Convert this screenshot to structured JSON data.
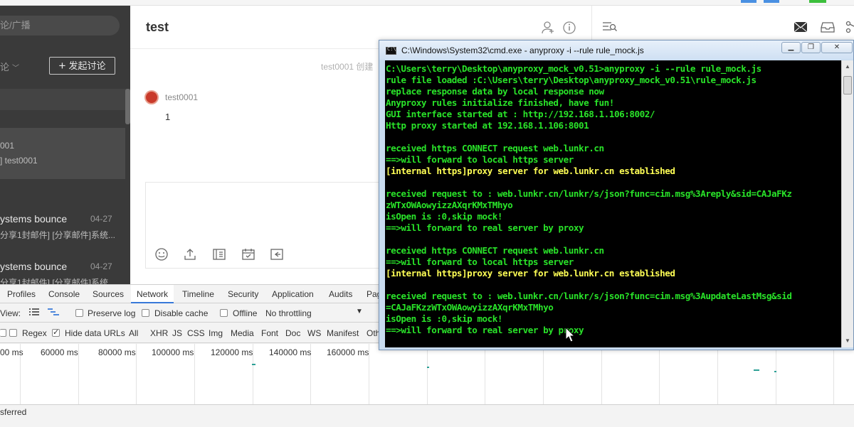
{
  "app": {
    "chat_title": "test",
    "search_placeholder": "论/广播",
    "sidebar_select": "论",
    "discuss_button": "发起讨论",
    "sidebar_active_line1": "001",
    "sidebar_active_line2": "] test0001",
    "sidebar_items": [
      {
        "title": "ystems bounce",
        "date": "04-27",
        "preview": "分享1封邮件] [分享邮件]系统..."
      },
      {
        "title": "ystems bounce",
        "date": "04-27",
        "preview": "分享1封邮件] [分享邮件]系统..."
      }
    ],
    "meta_text": "test0001  创建",
    "message_user": "test0001",
    "message_body": "1"
  },
  "devtools": {
    "tabs": [
      "Profiles",
      "Console",
      "Sources",
      "Network",
      "Timeline",
      "Security",
      "Application",
      "Audits",
      "Pag"
    ],
    "active_tab": "Network",
    "view_label": "View:",
    "preserve_log": "Preserve log",
    "disable_cache": "Disable cache",
    "offline": "Offline",
    "throttling": "No throttling",
    "regex": "Regex",
    "hide_data_urls": "Hide data URLs",
    "filters": [
      "All",
      "XHR",
      "JS",
      "CSS",
      "Img",
      "Media",
      "Font",
      "Doc",
      "WS",
      "Manifest",
      "Oth"
    ],
    "active_filter": "XHR",
    "ticks": [
      "00 ms",
      "60000 ms",
      "80000 ms",
      "100000 ms",
      "120000 ms",
      "140000 ms",
      "160000 ms"
    ],
    "status": "sferred"
  },
  "cmd": {
    "title": "C:\\Windows\\System32\\cmd.exe - anyproxy  -i --rule rule_mock.js",
    "lines": [
      {
        "text": "C:\\Users\\terry\\Desktop\\anyproxy_mock_v0.51>anyproxy -i --rule rule_mock.js",
        "color": "green"
      },
      {
        "text": "rule file loaded :C:\\Users\\terry\\Desktop\\anyproxy_mock_v0.51\\rule_mock.js",
        "color": "green"
      },
      {
        "text": "replace response data by local response now",
        "color": "green"
      },
      {
        "text": "Anyproxy rules initialize finished, have fun!",
        "color": "green"
      },
      {
        "text": "GUI interface started at : http://192.168.1.106:8002/",
        "color": "green"
      },
      {
        "text": "Http proxy started at 192.168.1.106:8001",
        "color": "green"
      },
      {
        "text": "",
        "color": "green"
      },
      {
        "text": "received https CONNECT request web.lunkr.cn",
        "color": "green"
      },
      {
        "text": "==>will forward to local https server",
        "color": "green"
      },
      {
        "text": "[internal https]proxy server for web.lunkr.cn established",
        "color": "yellow"
      },
      {
        "text": "",
        "color": "green"
      },
      {
        "text": "received request to : web.lunkr.cn/lunkr/s/json?func=cim.msg%3Areply&sid=CAJaFKz",
        "color": "green"
      },
      {
        "text": "zWTxOWAowyizzAXqrKMxTMhyo",
        "color": "green"
      },
      {
        "text": "isOpen is :0,skip mock!",
        "color": "green"
      },
      {
        "text": "==>will forward to real server by proxy",
        "color": "green"
      },
      {
        "text": "",
        "color": "green"
      },
      {
        "text": "received https CONNECT request web.lunkr.cn",
        "color": "green"
      },
      {
        "text": "==>will forward to local https server",
        "color": "green"
      },
      {
        "text": "[internal https]proxy server for web.lunkr.cn established",
        "color": "yellow"
      },
      {
        "text": "",
        "color": "green"
      },
      {
        "text": "received request to : web.lunkr.cn/lunkr/s/json?func=cim.msg%3AupdateLastMsg&sid",
        "color": "green"
      },
      {
        "text": "=CAJaFKzzWTxOWAowyizzAXqrKMxTMhyo",
        "color": "green"
      },
      {
        "text": "isOpen is :0,skip mock!",
        "color": "green"
      },
      {
        "text": "==>will forward to real server by proxy",
        "color": "green"
      }
    ]
  },
  "colors": {
    "accent_blue": "#3879d9",
    "console_green": "#29e329",
    "console_yellow": "#ffff55",
    "sidebar_bg": "#3a3a3a"
  }
}
